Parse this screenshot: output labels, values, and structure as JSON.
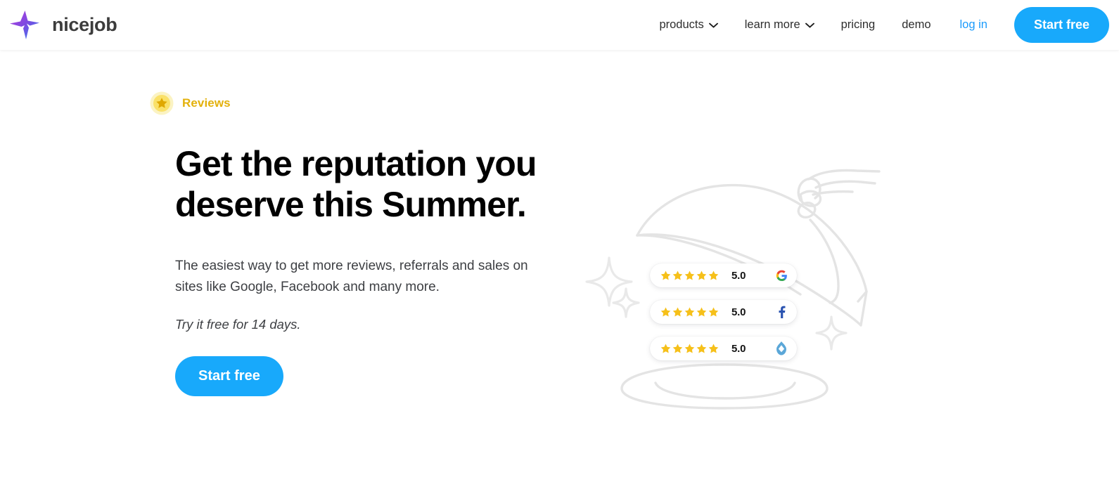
{
  "header": {
    "brand": {
      "name": "nicejob",
      "logo_icon": "nicejob-star-logo",
      "gradient_from": "#a33bdb",
      "gradient_to": "#2f7ff0"
    },
    "nav": [
      {
        "label": "products",
        "has_dropdown": true,
        "icon": "chevron-down-icon"
      },
      {
        "label": "learn more",
        "has_dropdown": true,
        "icon": "chevron-down-icon"
      },
      {
        "label": "pricing",
        "has_dropdown": false
      },
      {
        "label": "demo",
        "has_dropdown": false
      }
    ],
    "login_label": "log in",
    "login_color": "#1a9bfc",
    "cta_label": "Start free",
    "cta_color": "#18a9fb"
  },
  "hero": {
    "eyebrow": {
      "label": "Reviews",
      "icon": "star-badge-icon",
      "color": "#e3b10c"
    },
    "headline": "Get the reputation you deserve this Summer.",
    "subtext": "The easiest way to get more reviews, referrals and sales on sites like Google, Facebook and many more.",
    "trial_note": "Try it free for 14 days.",
    "cta_label": "Start free"
  },
  "illustration": {
    "name": "cloche-reveal-illustration",
    "line_color": "#e4e4e4",
    "elements": [
      "serving-dome-icon",
      "hand-icon",
      "platter-icon",
      "sparkle-icon",
      "sparkle-icon",
      "sparkle-icon"
    ],
    "review_cards": [
      {
        "stars": 5,
        "score": "5.0",
        "platform": "google",
        "platform_icon": "google-g-icon",
        "platform_color": "#ea4335"
      },
      {
        "stars": 5,
        "score": "5.0",
        "platform": "facebook",
        "platform_icon": "facebook-f-icon",
        "platform_color": "#2a53b0"
      },
      {
        "stars": 5,
        "score": "5.0",
        "platform": "nextdoor",
        "platform_icon": "nextdoor-diamond-icon",
        "platform_color": "#5ba7d8"
      }
    ],
    "star_color": "#f6c01a"
  }
}
